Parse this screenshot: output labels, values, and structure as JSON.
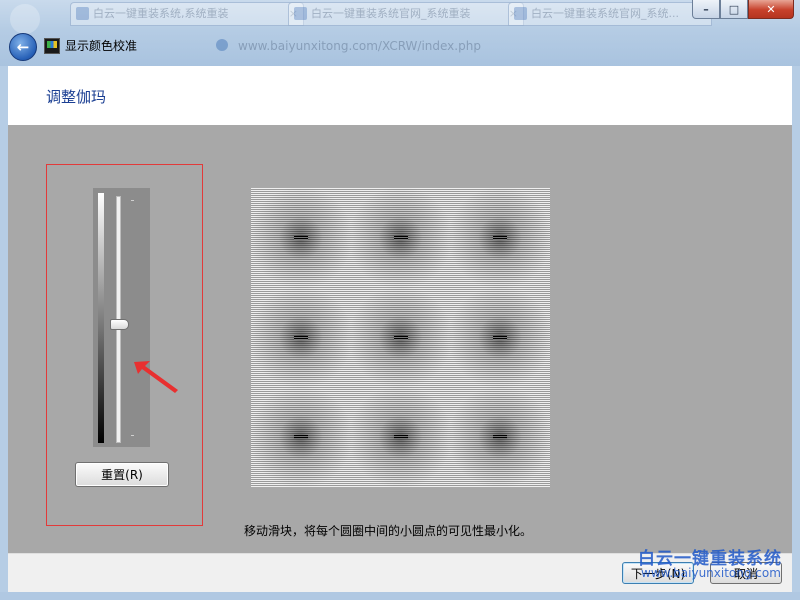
{
  "window": {
    "title": "显示颜色校准",
    "buttons": {
      "minimize": "–",
      "maximize": "□",
      "close": "✕"
    }
  },
  "background_browser": {
    "tabs": [
      "白云一键重装系统,系统重装",
      "白云一键重装系统官网_系统重装",
      "白云一键重装系统官网_系统..."
    ],
    "address": "www.baiyunxitong.com/XCRW/index.php"
  },
  "header": {
    "title": "调整伽玛"
  },
  "slider": {
    "reset_label": "重置(R)",
    "level_fraction": 0.52
  },
  "instruction": "移动滑块，将每个圆圈中间的小圆点的可见性最小化。",
  "footer": {
    "next_label": "下一步(N)",
    "cancel_label": "取消"
  },
  "watermark": {
    "brand": "白云一键重装系统",
    "url": "www.baiyunxitong.com"
  },
  "colors": {
    "title_blue": "#1b3f93",
    "highlight_red": "#e23a3a",
    "panel_gray": "#a8a8a8"
  },
  "icons": {
    "back": "back-arrow-icon",
    "app": "display-calibration-icon",
    "annotation": "red-arrow-icon"
  }
}
